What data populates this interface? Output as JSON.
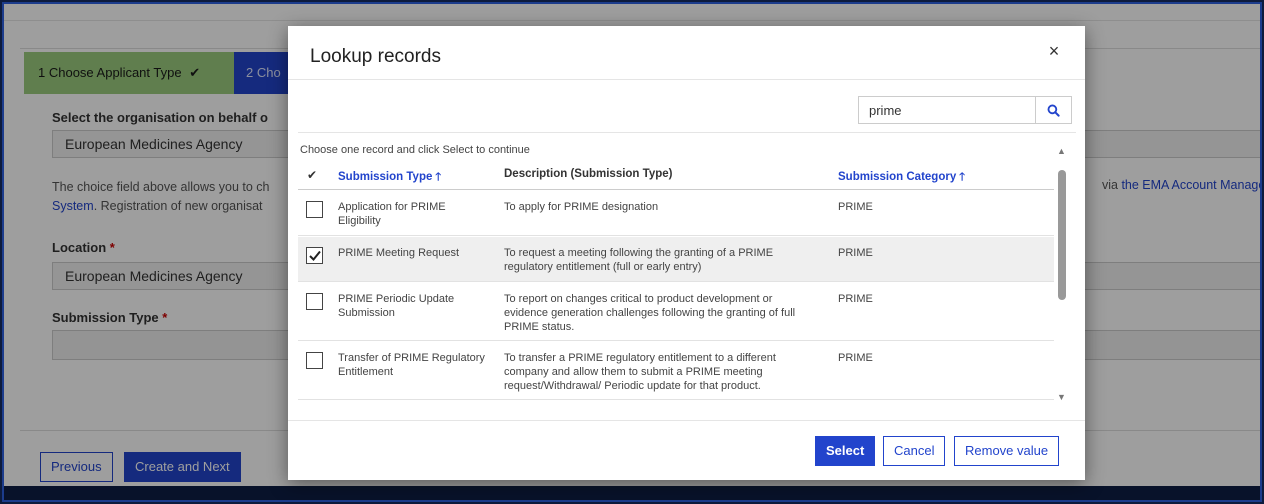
{
  "background": {
    "step1_label": "1  Choose Applicant Type",
    "step1_check": "✔",
    "step2_label": "2  Cho",
    "org_label": "Select the organisation on behalf o",
    "org_value": "European Medicines Agency",
    "info_text_1": "The choice field above allows you to ch",
    "info_link_1": "System",
    "info_text_2": ". Registration of new organisat",
    "info_right_text": "via ",
    "info_right_link": "the EMA Account Manage",
    "location_label": "Location",
    "location_value": "European Medicines Agency",
    "submission_type_label": "Submission Type",
    "required_mark": "*",
    "previous_label": "Previous",
    "create_next_label": "Create and Next"
  },
  "modal": {
    "title": "Lookup records",
    "close_glyph": "×",
    "search_value": "prime",
    "hint": "Choose one record and click Select to continue",
    "columns": {
      "check": "✔",
      "type": "Submission Type",
      "description": "Description (Submission Type)",
      "category": "Submission Category",
      "sort_arrow": "🡑"
    },
    "rows": [
      {
        "type": "Application for PRIME Eligibility",
        "description": "To apply for PRIME designation",
        "category": "PRIME",
        "checked": false
      },
      {
        "type": "PRIME Meeting Request",
        "description": "To request a meeting following the granting of a PRIME regulatory entitlement (full or early entry)",
        "category": "PRIME",
        "checked": true
      },
      {
        "type": "PRIME Periodic Update Submission",
        "description": "To report on changes critical to product development or evidence generation challenges following the granting of full PRIME status.",
        "category": "PRIME",
        "checked": false
      },
      {
        "type": "Transfer of PRIME Regulatory Entitlement",
        "description": "To transfer a PRIME regulatory entitlement to a different company and allow them to submit a PRIME meeting request/Withdrawal/ Periodic update for that product.",
        "category": "PRIME",
        "checked": false
      }
    ],
    "buttons": {
      "select": "Select",
      "cancel": "Cancel",
      "remove": "Remove value"
    }
  },
  "colors": {
    "accent": "#2244cc",
    "step_complete": "#9ccc7e",
    "selected_row": "#efefef"
  }
}
